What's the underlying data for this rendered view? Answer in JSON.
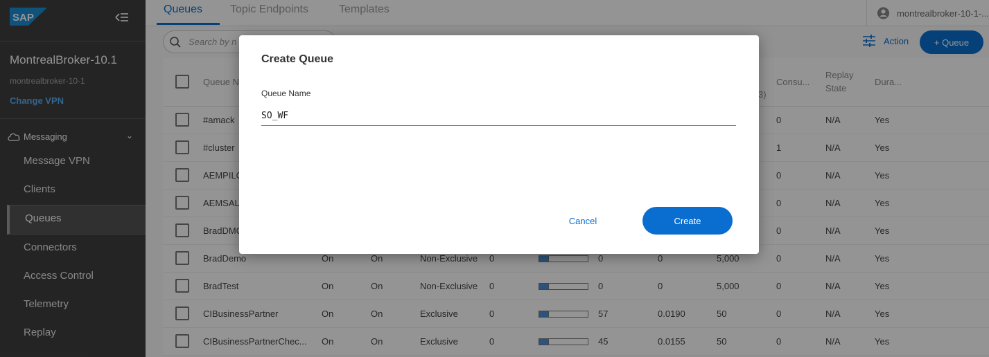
{
  "sidebar": {
    "logo_text": "SAP",
    "broker_name": "MontrealBroker-10.1",
    "broker_id": "montrealbroker-10-1",
    "change_vpn": "Change VPN",
    "section_label": "Messaging",
    "items": [
      {
        "label": "Message VPN"
      },
      {
        "label": "Clients"
      },
      {
        "label": "Queues"
      },
      {
        "label": "Connectors"
      },
      {
        "label": "Access Control"
      },
      {
        "label": "Telemetry"
      },
      {
        "label": "Replay"
      }
    ],
    "active_item": "Queues"
  },
  "tabs": [
    {
      "label": "Queues"
    },
    {
      "label": "Topic Endpoints"
    },
    {
      "label": "Templates"
    }
  ],
  "user": {
    "label": "montrealbroker-10-1-..."
  },
  "search": {
    "placeholder": "Search by n"
  },
  "toolbar": {
    "action_label": "Action",
    "add_queue_label": "+ Queue"
  },
  "table": {
    "headers": [
      "Queue N",
      "Consu...",
      "Replay State",
      "Dura..."
    ],
    "partial_header_fragment": "3)",
    "rows": [
      {
        "name": "#amack",
        "c1": "",
        "c2": "",
        "access": "",
        "c4": "",
        "usage": null,
        "c6": "",
        "c7": "",
        "c8": "",
        "consumers": "0",
        "replay": "N/A",
        "durable": "Yes"
      },
      {
        "name": "#cluster",
        "c1": "",
        "c2": "",
        "access": "",
        "c4": "",
        "usage": null,
        "c6": "",
        "c7": "",
        "c8": "",
        "consumers": "1",
        "replay": "N/A",
        "durable": "Yes"
      },
      {
        "name": "AEMPILO",
        "c1": "",
        "c2": "",
        "access": "",
        "c4": "",
        "usage": null,
        "c6": "",
        "c7": "",
        "c8": "",
        "consumers": "0",
        "replay": "N/A",
        "durable": "Yes"
      },
      {
        "name": "AEMSAL",
        "c1": "",
        "c2": "",
        "access": "",
        "c4": "",
        "usage": null,
        "c6": "",
        "c7": "",
        "c8": "",
        "consumers": "0",
        "replay": "N/A",
        "durable": "Yes"
      },
      {
        "name": "BradDMC",
        "c1": "",
        "c2": "",
        "access": "",
        "c4": "",
        "usage": null,
        "c6": "",
        "c7": "",
        "c8": "",
        "consumers": "0",
        "replay": "N/A",
        "durable": "Yes"
      },
      {
        "name": "BradDemo",
        "c1": "On",
        "c2": "On",
        "access": "Non-Exclusive",
        "c4": "0",
        "usage": 0.2,
        "c6": "0",
        "c7": "0",
        "c8": "5,000",
        "consumers": "0",
        "replay": "N/A",
        "durable": "Yes"
      },
      {
        "name": "BradTest",
        "c1": "On",
        "c2": "On",
        "access": "Non-Exclusive",
        "c4": "0",
        "usage": 0.2,
        "c6": "0",
        "c7": "0",
        "c8": "5,000",
        "consumers": "0",
        "replay": "N/A",
        "durable": "Yes"
      },
      {
        "name": "CIBusinessPartner",
        "c1": "On",
        "c2": "On",
        "access": "Exclusive",
        "c4": "0",
        "usage": 0.2,
        "c6": "57",
        "c7": "0.0190",
        "c8": "50",
        "consumers": "0",
        "replay": "N/A",
        "durable": "Yes"
      },
      {
        "name": "CIBusinessPartnerChec...",
        "c1": "On",
        "c2": "On",
        "access": "Exclusive",
        "c4": "0",
        "usage": 0.2,
        "c6": "45",
        "c7": "0.0155",
        "c8": "50",
        "consumers": "0",
        "replay": "N/A",
        "durable": "Yes"
      }
    ]
  },
  "dialog": {
    "title": "Create Queue",
    "field_label": "Queue Name",
    "field_value": "SO_WF",
    "cancel_label": "Cancel",
    "create_label": "Create"
  },
  "colors": {
    "accent": "#0a6ed1",
    "sidebar_bg": "#3f3f3f",
    "link": "#5aaef5"
  }
}
